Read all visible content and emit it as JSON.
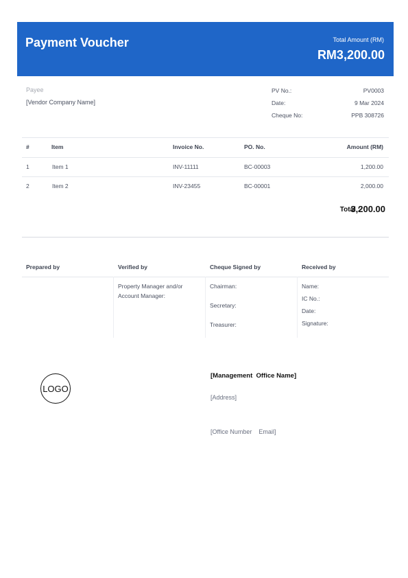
{
  "header": {
    "title": "Payment Voucher",
    "total_label": "Total Amount (RM)",
    "total_value": "RM3,200.00",
    "accent_color": "#1f66c8"
  },
  "payee": {
    "label": "Payee",
    "name": "[Vendor Company Name]"
  },
  "meta": [
    {
      "key": "PV No.:",
      "value": "PV0003"
    },
    {
      "key": "Date:",
      "value": "9 Mar 2024"
    },
    {
      "key": "Cheque No:",
      "value": "PPB 308726"
    }
  ],
  "items_table": {
    "headers": [
      "#",
      "Item",
      "Invoice No.",
      "PO. No.",
      "Amount (RM)"
    ],
    "rows": [
      [
        "1",
        "Item 1",
        "INV-11111",
        "BC-00003",
        "1,200.00"
      ],
      [
        "2",
        "Item 2",
        "INV-23455",
        "BC-00001",
        "2,000.00"
      ]
    ]
  },
  "total": {
    "label": "Total :",
    "value": "3,200.00"
  },
  "signatures": [
    {
      "heading": "Prepared by",
      "lines": []
    },
    {
      "heading": "Verified by",
      "lines": [
        "Property Manager and/or",
        "Account Manager:"
      ]
    },
    {
      "heading": "Cheque Signed by",
      "lines": [
        "Chairman:",
        "Secretary:",
        "Treasurer:"
      ]
    },
    {
      "heading": "Received by",
      "lines": [
        "Name:",
        "IC No.:",
        "Date:",
        "Signature:"
      ]
    }
  ],
  "footer": {
    "logo_text": "LOGO",
    "office_name": "[Management  Office Name]",
    "address": "[Address]",
    "contact": "[Office Number    Email]"
  }
}
